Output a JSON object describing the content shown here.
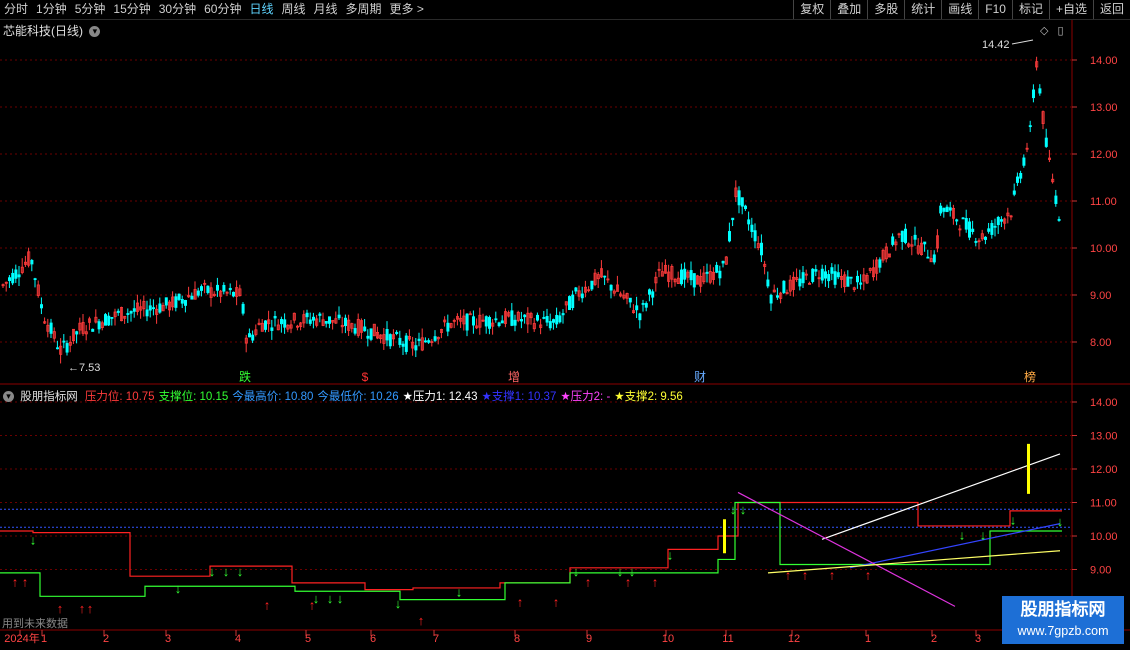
{
  "toolbar": {
    "periods": [
      "分时",
      "1分钟",
      "5分钟",
      "15分钟",
      "30分钟",
      "60分钟",
      "日线",
      "周线",
      "月线",
      "多周期",
      "更多 >"
    ],
    "active_period": "日线",
    "right_buttons": [
      "复权",
      "叠加",
      "多股",
      "统计",
      "画线",
      "F10",
      "标记",
      "+自选",
      "返回"
    ]
  },
  "stock": {
    "title": "芯能科技(日线)",
    "price_axis": [
      "14.00",
      "13.00",
      "12.00",
      "11.00",
      "10.00",
      "9.00",
      "8.00"
    ],
    "high_label": "14.42",
    "low_label": "7.53",
    "event_tags": [
      "跌",
      "$",
      "增",
      "财",
      "榜"
    ]
  },
  "indicator": {
    "name": "股朋指标网",
    "items": [
      {
        "label": "压力位:",
        "value": "10.75",
        "color": "#ff3b3b"
      },
      {
        "label": "支撑位:",
        "value": "10.15",
        "color": "#33ff33"
      },
      {
        "label": "今最高价:",
        "value": "10.80",
        "color": "#3399ff"
      },
      {
        "label": "今最低价:",
        "value": "10.26",
        "color": "#3399ff"
      },
      {
        "label": "★压力1:",
        "value": "12.43",
        "color": "#ffffff"
      },
      {
        "label": "★支撑1:",
        "value": "10.37",
        "color": "#3333ff"
      },
      {
        "label": "★压力2:",
        "value": "-",
        "color": "#ff44ff"
      },
      {
        "label": "★支撑2:",
        "value": "9.56",
        "color": "#ffff33"
      }
    ],
    "price_axis": [
      "14.00",
      "13.00",
      "12.00",
      "11.00",
      "10.00",
      "9.00"
    ],
    "footer_note": "用到未来数据"
  },
  "xaxis": {
    "labels": [
      "2024年",
      "1",
      "2",
      "3",
      "4",
      "5",
      "6",
      "7",
      "8",
      "9",
      "10",
      "11",
      "12",
      "1",
      "2",
      "3"
    ]
  },
  "watermark": {
    "line1": "股朋指标网",
    "line2": "www.7gpzb.com"
  },
  "colors": {
    "up": "#ff3b3b",
    "down": "#00ffff",
    "grid": "#6b0000",
    "support": "#33ff33",
    "resist": "#ff2222"
  }
}
